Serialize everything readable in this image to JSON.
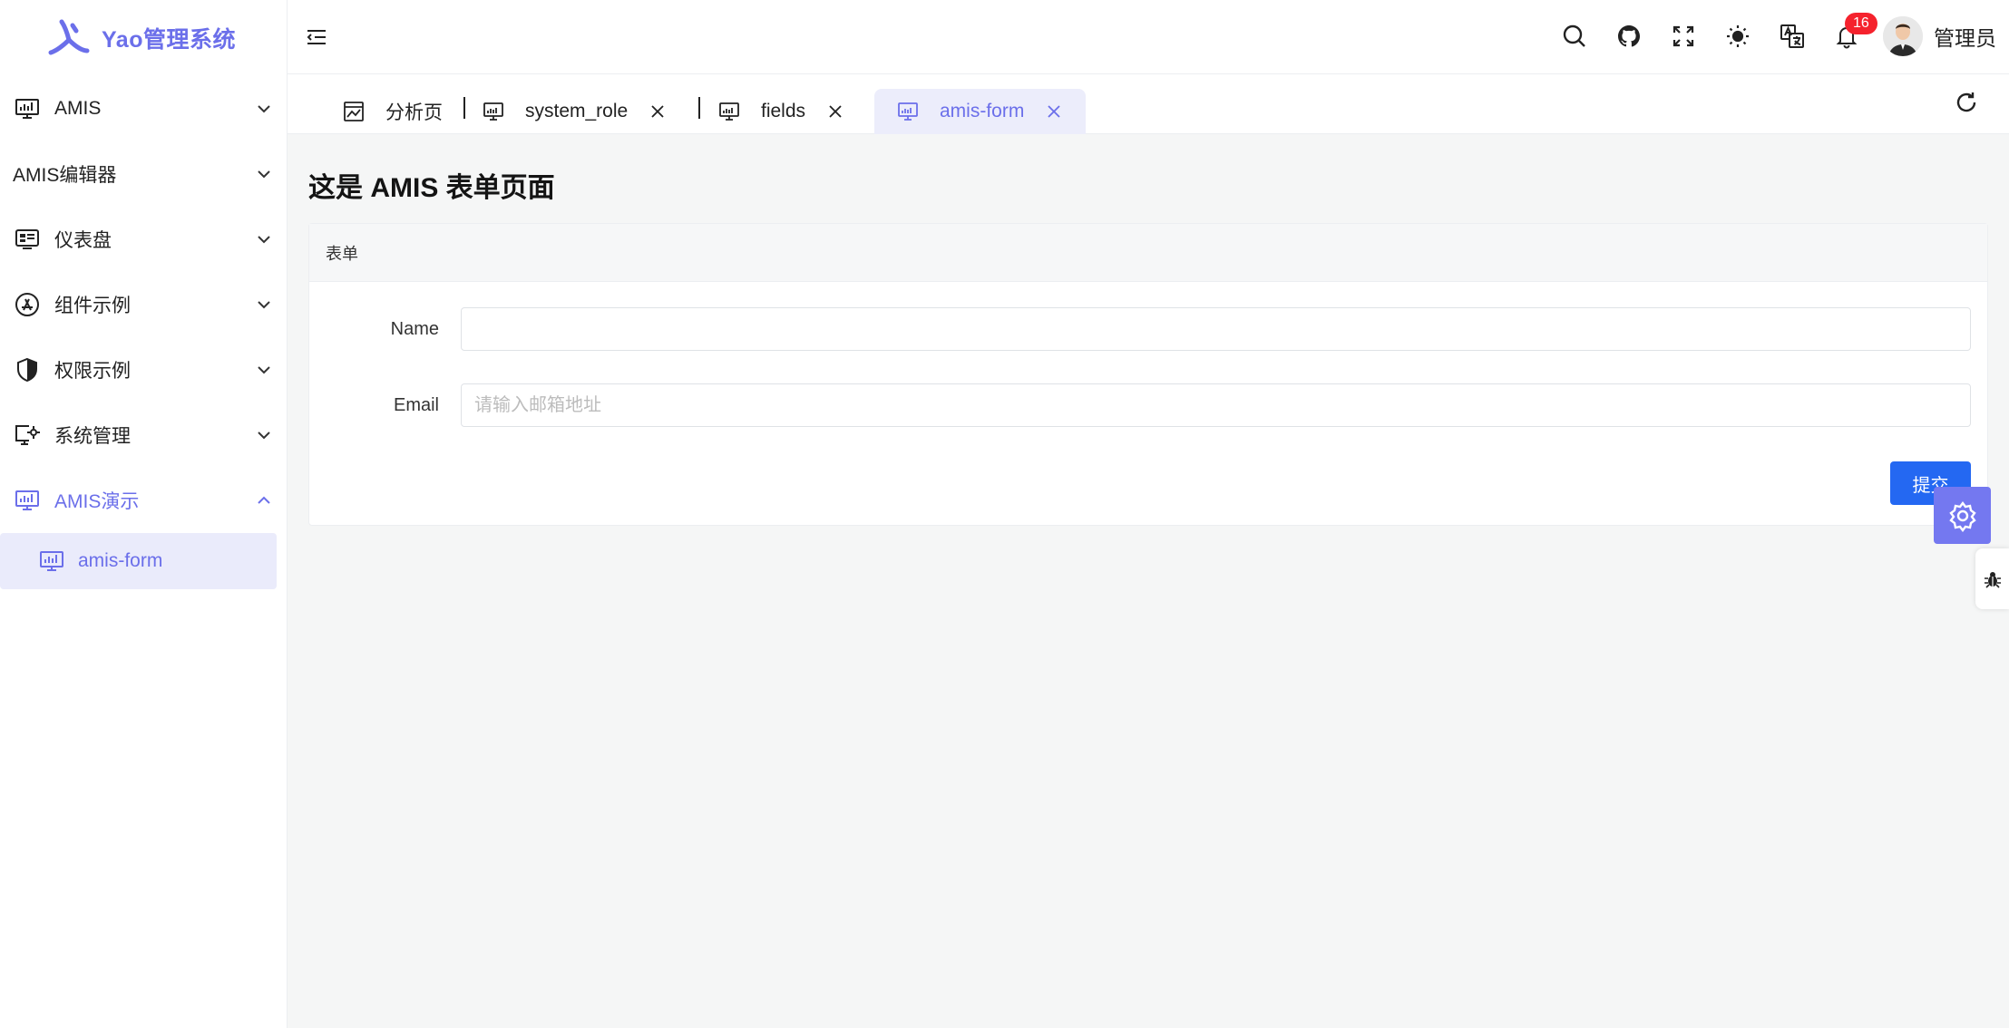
{
  "app": {
    "title": "Yao管理系统"
  },
  "sidebar": {
    "items": [
      {
        "label": "AMIS",
        "icon": "monitor-chart-icon",
        "expanded": false
      },
      {
        "label": "AMIS编辑器",
        "icon": "",
        "expanded": false
      },
      {
        "label": "仪表盘",
        "icon": "dashboard-icon",
        "expanded": false
      },
      {
        "label": "组件示例",
        "icon": "app-store-icon",
        "expanded": false
      },
      {
        "label": "权限示例",
        "icon": "shield-icon",
        "expanded": false
      },
      {
        "label": "系统管理",
        "icon": "monitor-settings-icon",
        "expanded": false
      },
      {
        "label": "AMIS演示",
        "icon": "monitor-chart-icon",
        "expanded": true
      }
    ],
    "sub_items": [
      {
        "label": "amis-form",
        "icon": "monitor-chart-icon",
        "active": true
      }
    ]
  },
  "header": {
    "notification_count": "16",
    "user_name": "管理员",
    "icons": [
      "menu-collapse-icon",
      "search-icon",
      "github-icon",
      "fullscreen-icon",
      "theme-sun-icon",
      "translate-icon",
      "bell-icon"
    ]
  },
  "tabs": [
    {
      "label": "分析页",
      "closable": false,
      "active": false
    },
    {
      "label": "system_role",
      "closable": true,
      "active": false
    },
    {
      "label": "fields",
      "closable": true,
      "active": false
    },
    {
      "label": "amis-form",
      "closable": true,
      "active": true
    }
  ],
  "page": {
    "title": "这是 AMIS 表单页面",
    "panel_title": "表单",
    "fields": [
      {
        "label": "Name",
        "value": "",
        "placeholder": ""
      },
      {
        "label": "Email",
        "value": "",
        "placeholder": "请输入邮箱地址"
      }
    ],
    "submit_label": "提交"
  },
  "colors": {
    "accent": "#6b6fea",
    "primary_button": "#2468f2",
    "badge": "#f5222d",
    "float_button": "#7478f0"
  }
}
